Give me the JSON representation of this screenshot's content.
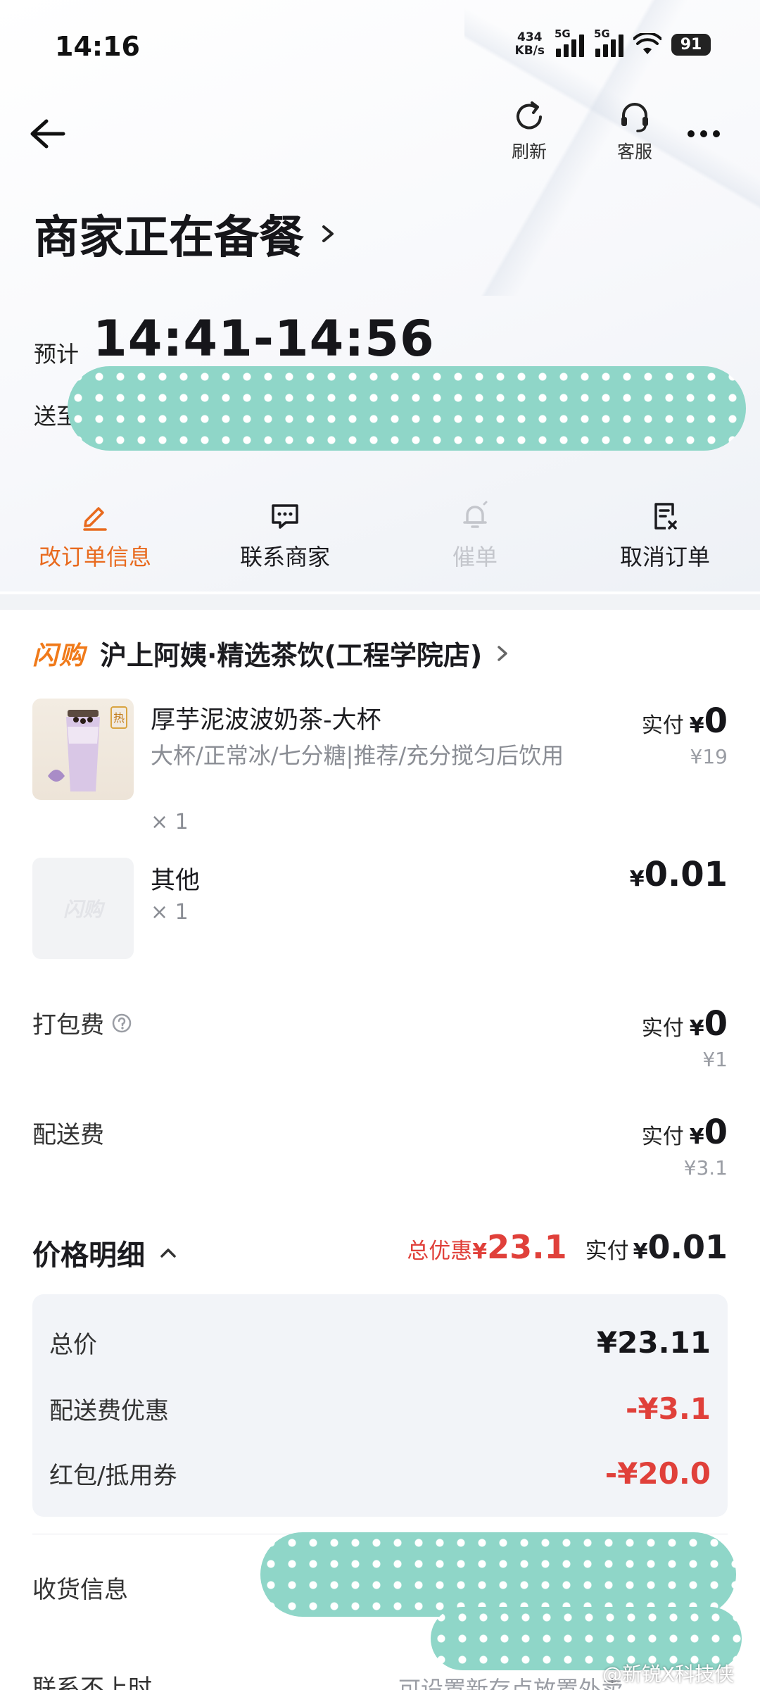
{
  "status_bar": {
    "time": "14:16",
    "net_speed_value": "434",
    "net_speed_unit": "KB/s",
    "signal_1_label": "5G",
    "signal_2_label": "5G",
    "battery": "91"
  },
  "header": {
    "refresh_label": "刷新",
    "service_label": "客服"
  },
  "order_status": {
    "title": "商家正在备餐",
    "eta_label": "预计",
    "eta_time": "14:41-14:56",
    "deliver_label": "送至"
  },
  "actions": [
    {
      "label": "改订单信息",
      "icon": "edit-icon",
      "color": "#e86a1e"
    },
    {
      "label": "联系商家",
      "icon": "chat-icon",
      "color": "#1b1b1f"
    },
    {
      "label": "催单",
      "icon": "bell-icon",
      "color": "#c4c6cc"
    },
    {
      "label": "取消订单",
      "icon": "cancel-order-icon",
      "color": "#1b1b1f"
    }
  ],
  "shop": {
    "brand": "闪购",
    "name": "沪上阿姨·精选茶饮(工程学院店)"
  },
  "items": [
    {
      "name": "厚芋泥波波奶茶-大杯",
      "spec": "大杯/正常冰/七分糖|推荐/充分搅匀后饮用",
      "qty": "× 1",
      "paid_label": "实付",
      "paid_yen": "¥",
      "paid_value": "0",
      "original": "¥19",
      "thumb_badge": "热"
    },
    {
      "name": "其他",
      "spec": "",
      "qty": "× 1",
      "paid_label": "",
      "paid_yen": "¥",
      "paid_value": "0.01",
      "original": "",
      "thumb_text": "闪购"
    }
  ],
  "fees": [
    {
      "label": "打包费",
      "paid_label": "实付",
      "paid_yen": "¥",
      "paid_value": "0",
      "original": "¥1"
    },
    {
      "label": "配送费",
      "paid_label": "实付",
      "paid_yen": "¥",
      "paid_value": "0",
      "original": "¥3.1"
    }
  ],
  "price_detail": {
    "title": "价格明细",
    "discount_label": "总优惠",
    "discount_yen": "¥",
    "discount_value": "23.1",
    "paid_label": "实付",
    "paid_yen": "¥",
    "paid_value": "0.01",
    "rows": [
      {
        "label": "总价",
        "value": "¥23.11",
        "color": "#16161a"
      },
      {
        "label": "配送费优惠",
        "value": "-¥3.1",
        "color": "#e0403a"
      },
      {
        "label": "红包/抵用券",
        "value": "-¥20.0",
        "color": "#e0403a"
      }
    ]
  },
  "receive": {
    "label": "收货信息"
  },
  "contact": {
    "label": "联系不上时",
    "hint": "可设置新存点放置外卖"
  },
  "watermark": "@新锐X科技侠"
}
